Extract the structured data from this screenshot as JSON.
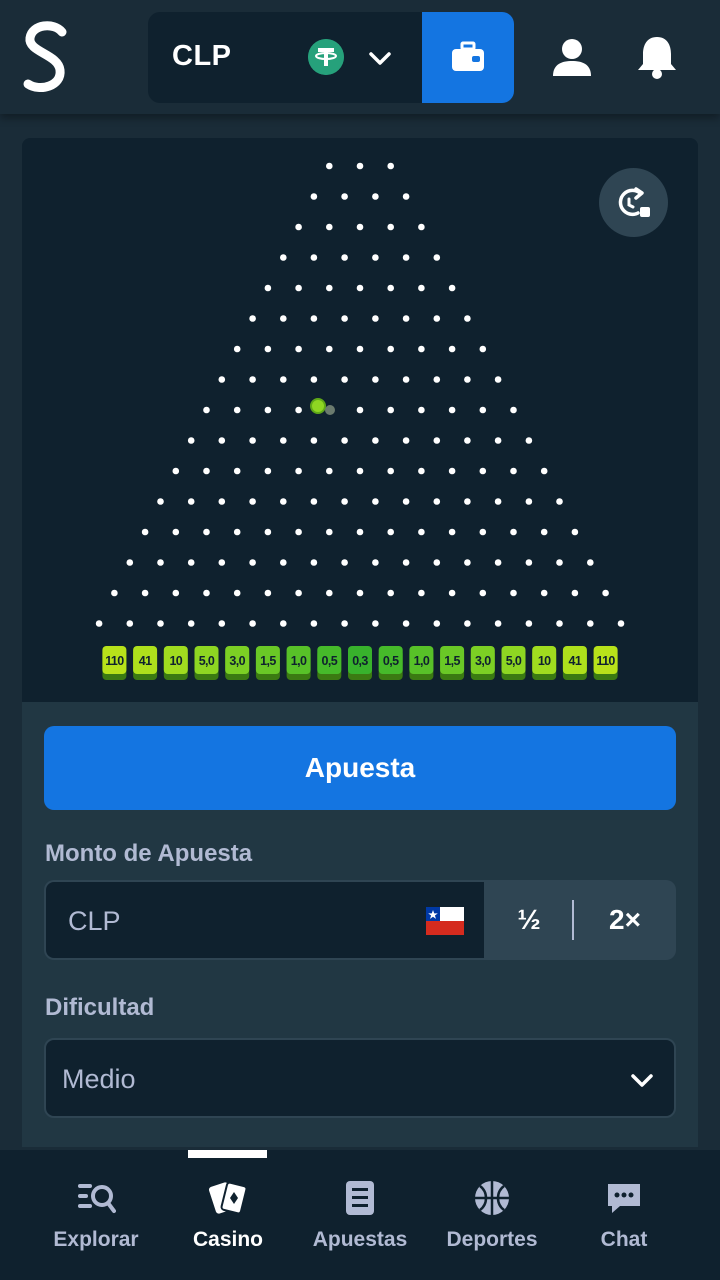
{
  "header": {
    "currency": "CLP",
    "currency_icon": "tether-icon",
    "wallet_icon": "wallet-icon",
    "user_icon": "user-icon",
    "bell_icon": "bell-icon"
  },
  "game": {
    "stats_icon": "stats-icon",
    "peg_rows": 16,
    "first_row_pegs": 3,
    "multipliers": [
      "110",
      "41",
      "10",
      "5,0",
      "3,0",
      "1,5",
      "1,0",
      "0,5",
      "0,3",
      "0,5",
      "1,0",
      "1,5",
      "3,0",
      "5,0",
      "10",
      "41",
      "110"
    ],
    "multiplier_colors": [
      "#b8e21a",
      "#aee01c",
      "#a0dc1f",
      "#8ed622",
      "#7ccf24",
      "#6ac826",
      "#58c128",
      "#46ba2a",
      "#38b22c",
      "#46ba2a",
      "#58c128",
      "#6ac826",
      "#7ccf24",
      "#8ed622",
      "#a0dc1f",
      "#aee01c",
      "#b8e21a"
    ],
    "ball_color": "#8ed622"
  },
  "controls": {
    "bet_label": "Apuesta",
    "amount_label": "Monto de Apuesta",
    "amount_value": "CLP",
    "half_label": "½",
    "double_label": "2×",
    "difficulty_label": "Dificultad",
    "difficulty_value": "Medio"
  },
  "nav": {
    "items": [
      {
        "label": "Explorar",
        "icon": "search-icon"
      },
      {
        "label": "Casino",
        "icon": "cards-icon"
      },
      {
        "label": "Apuestas",
        "icon": "list-icon"
      },
      {
        "label": "Deportes",
        "icon": "basketball-icon"
      },
      {
        "label": "Chat",
        "icon": "chat-icon"
      }
    ],
    "active": "Casino"
  },
  "colors": {
    "accent": "#1475e1",
    "background": "#1a2c38",
    "panel": "#0f212e"
  }
}
